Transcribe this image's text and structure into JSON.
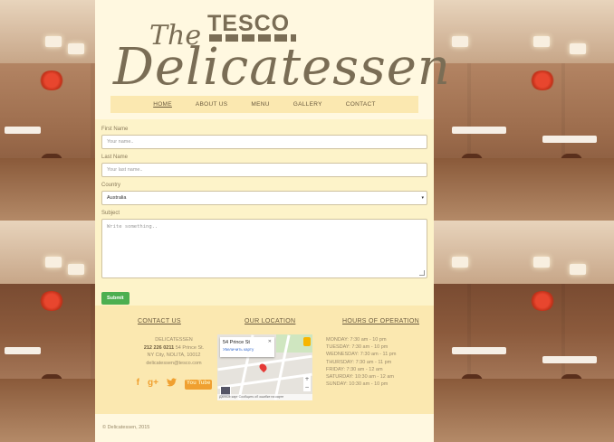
{
  "brand": {
    "tesco": "TESCO",
    "the": "The",
    "name": "Delicatessen"
  },
  "nav": {
    "items": [
      "HOME",
      "ABOUT US",
      "MENU",
      "GALLERY",
      "CONTACT"
    ],
    "active": "HOME"
  },
  "form": {
    "first_name_label": "First Name",
    "first_name_placeholder": "Your name..",
    "last_name_label": "Last Name",
    "last_name_placeholder": "Your last name..",
    "country_label": "Country",
    "country_value": "Australia",
    "subject_label": "Subject",
    "subject_placeholder": "Write something..",
    "submit_label": "Submit"
  },
  "footer": {
    "contact_title": "CONTACT US",
    "location_title": "OUR LOCATION",
    "hours_title": "HOURS OF OPERATION",
    "contact": {
      "name": "DELICATESSEN",
      "phone": "212 226 0211",
      "address1": "54 Prince St.",
      "address2": "NY City, NOLITA, 10012",
      "email": "delicatessen@tesco.com"
    },
    "social": [
      "f",
      "g+",
      "twitter",
      "You Tube"
    ],
    "map": {
      "popup_title": "54 Prince St",
      "popup_link": "Увеличить карту",
      "attribution": "Данные карт  Сообщить об ошибке на карте"
    },
    "hours": [
      "MONDAY: 7:30 am - 10 pm",
      "TUESDAY: 7:30 am - 10 pm",
      "WEDNESDAY: 7:30 am - 11 pm",
      "THURSDAY: 7:30 am - 11 pm",
      "FRIDAY: 7:30 am - 12 am",
      "SATURDAY: 10:30 am - 12 am",
      "SUNDAY: 10:30 am - 10 pm"
    ],
    "copyright": "© Delicatessen, 2015"
  },
  "colors": {
    "panel": "#fdf3c9",
    "nav_bg": "#fbe8b0",
    "text_brown": "#7a6d55",
    "submit_green": "#4caf50",
    "social_orange": "#f0a030"
  }
}
